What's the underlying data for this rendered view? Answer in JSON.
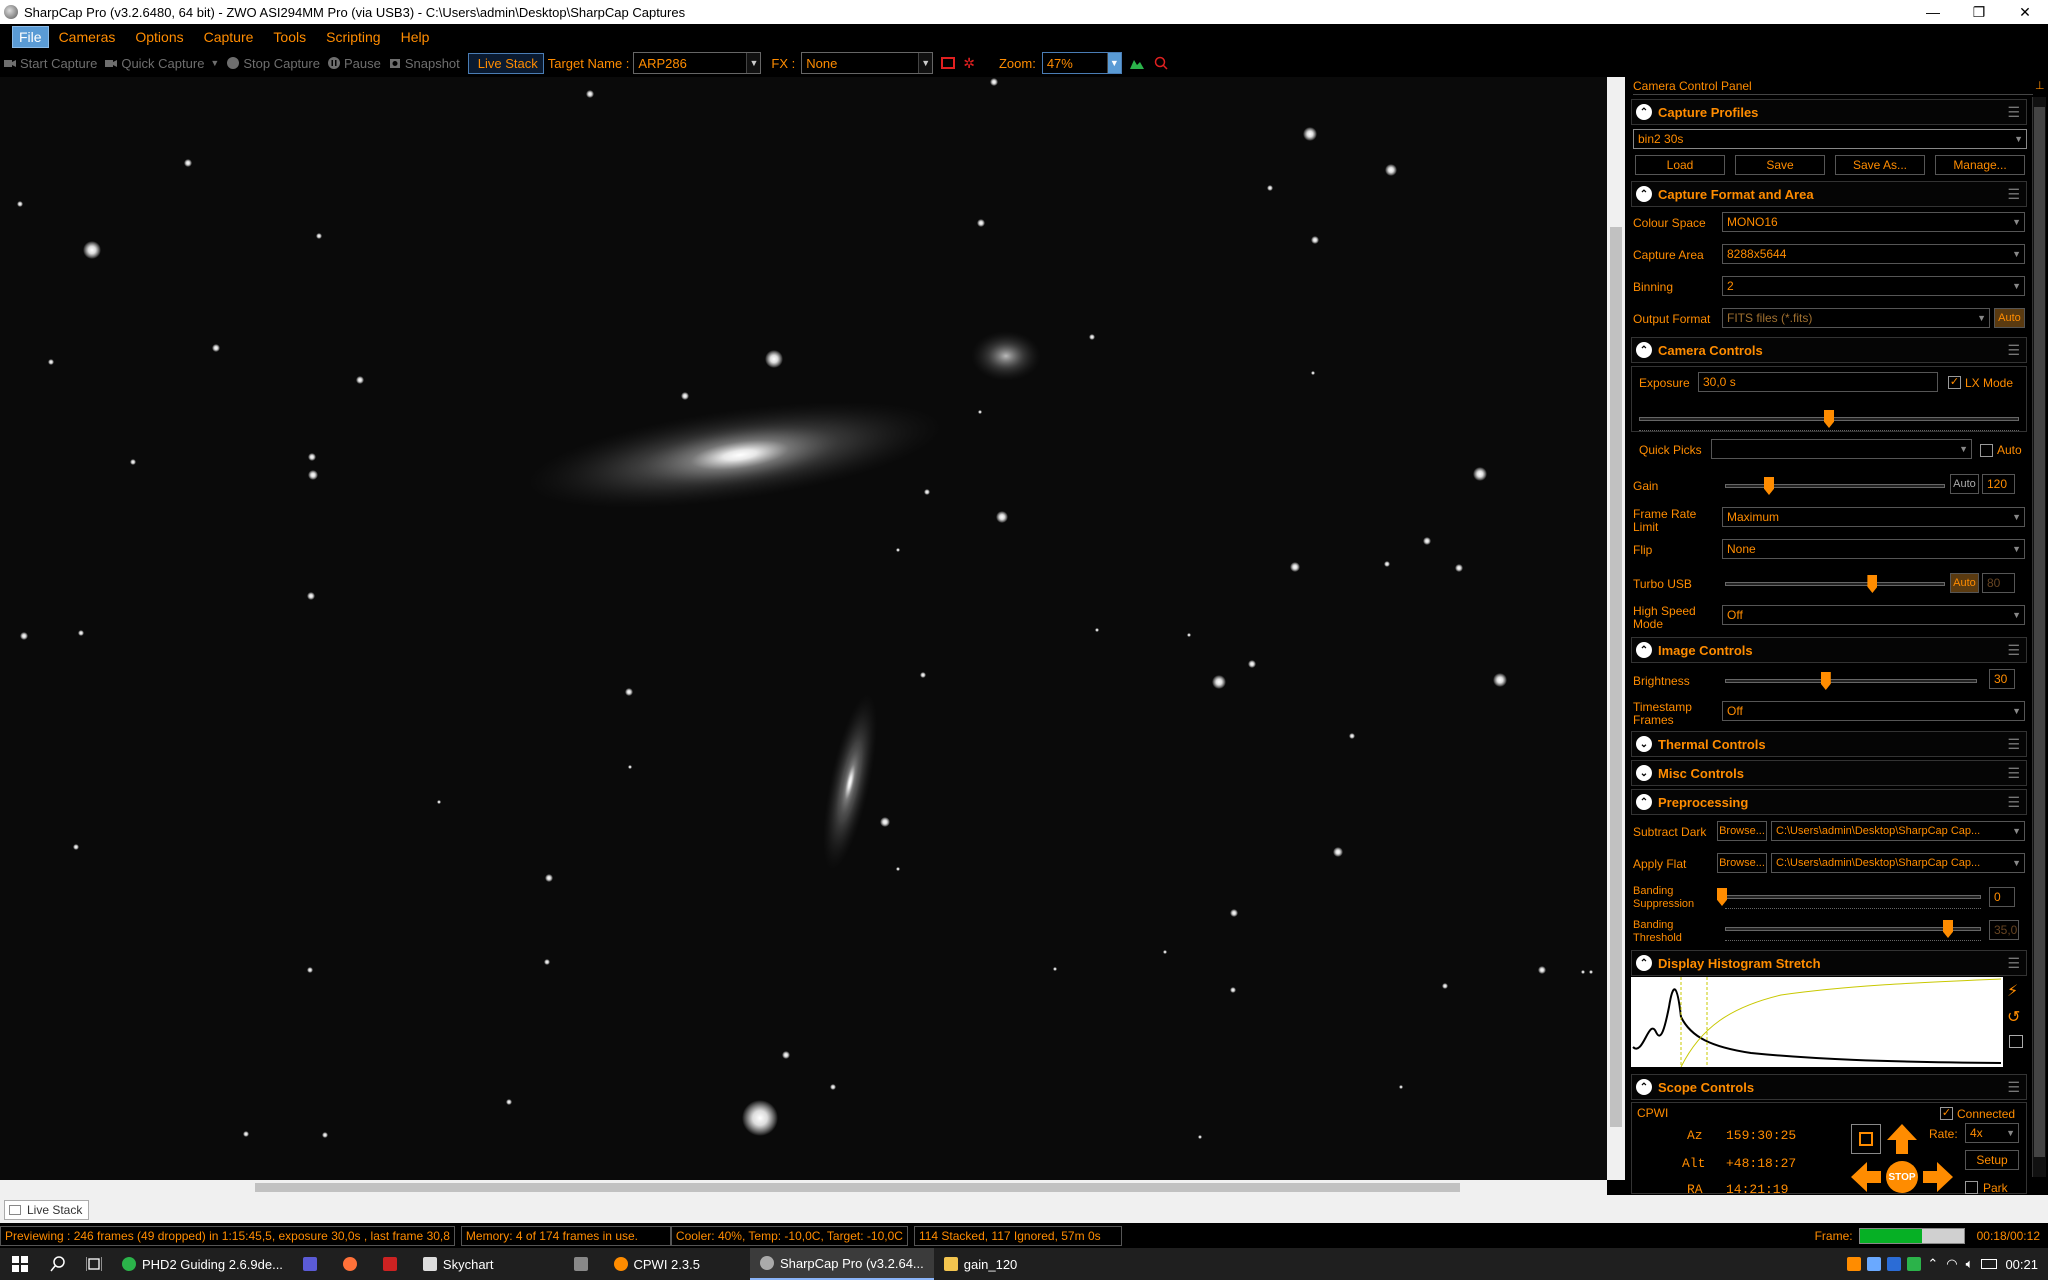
{
  "window": {
    "title": "SharpCap Pro (v3.2.6480, 64 bit) - ZWO ASI294MM Pro (via USB3) - C:\\Users\\admin\\Desktop\\SharpCap Captures",
    "minimize": "—",
    "restore": "❐",
    "close": "✕"
  },
  "menu": [
    "File",
    "Cameras",
    "Options",
    "Capture",
    "Tools",
    "Scripting",
    "Help"
  ],
  "toolbar": {
    "start_capture": "Start Capture",
    "quick_capture": "Quick Capture",
    "stop_capture": "Stop Capture",
    "pause": "Pause",
    "snapshot": "Snapshot",
    "live_stack": "Live Stack",
    "target_label": "Target Name :",
    "target_value": "ARP286",
    "fx_label": "FX :",
    "fx_value": "None",
    "zoom_label": "Zoom:",
    "zoom_value": "47%"
  },
  "viewer": {
    "live_stack_tab": "Live Stack"
  },
  "status": {
    "preview": "Previewing : 246 frames (49 dropped) in 1:15:45,5, exposure 30,0s , last frame 30,8",
    "memory": "Memory: 4 of 174 frames in use.",
    "cooler": "Cooler: 40%, Temp: -10,0C, Target: -10,0C",
    "stack": "114 Stacked, 117 Ignored, 57m 0s",
    "frame_label": "Frame:",
    "frame_progress": 0.6,
    "frame_time": "00:18/00:12"
  },
  "panel": {
    "title": "Camera Control Panel",
    "capture_profiles": {
      "header": "Capture Profiles",
      "selected": "bin2 30s",
      "load": "Load",
      "save": "Save",
      "save_as": "Save As...",
      "manage": "Manage..."
    },
    "format": {
      "header": "Capture Format and Area",
      "colour_space_label": "Colour Space",
      "colour_space": "MONO16",
      "capture_area_label": "Capture Area",
      "capture_area": "8288x5644",
      "binning_label": "Binning",
      "binning": "2",
      "output_format_label": "Output Format",
      "output_format": "FITS files (*.fits)",
      "auto": "Auto"
    },
    "camera": {
      "header": "Camera Controls",
      "exposure_label": "Exposure",
      "exposure": "30,0 s",
      "lx_mode": "LX Mode",
      "quick_picks_label": "Quick Picks",
      "auto": "Auto",
      "gain_label": "Gain",
      "gain": "120",
      "gain_level": 0.2,
      "frame_rate_label": "Frame Rate Limit",
      "frame_rate": "Maximum",
      "flip_label": "Flip",
      "flip": "None",
      "turbo_label": "Turbo USB",
      "turbo": "80",
      "turbo_level": 0.67,
      "high_speed_label": "High Speed Mode",
      "high_speed": "Off",
      "exposure_level": 0.5
    },
    "image": {
      "header": "Image Controls",
      "brightness_label": "Brightness",
      "brightness": "30",
      "brightness_level": 0.4,
      "timestamp_label": "Timestamp Frames",
      "timestamp": "Off"
    },
    "thermal": {
      "header": "Thermal Controls"
    },
    "misc": {
      "header": "Misc Controls"
    },
    "pre": {
      "header": "Preprocessing",
      "dark_label": "Subtract Dark",
      "flat_label": "Apply Flat",
      "browse": "Browse...",
      "dark_path": "C:\\Users\\admin\\Desktop\\SharpCap Cap...",
      "flat_path": "C:\\Users\\admin\\Desktop\\SharpCap Cap...",
      "banding_supp_label": "Banding Suppression",
      "banding_supp": "0",
      "banding_thr_label": "Banding Threshold",
      "banding_thr": "35,0"
    },
    "histogram": {
      "header": "Display Histogram Stretch"
    },
    "scope": {
      "header": "Scope Controls",
      "mount": "CPWI",
      "connected": "Connected",
      "az_label": "Az",
      "az": "159:30:25",
      "alt_label": "Alt",
      "alt": "+48:18:27",
      "ra_label": "RA",
      "ra": "14:21:19",
      "rate_label": "Rate:",
      "rate": "4x",
      "setup": "Setup",
      "stop": "STOP",
      "park": "Park"
    }
  },
  "taskbar": {
    "items": [
      "PHD2 Guiding 2.6.9de...",
      "Skychart",
      "CPWI 2.3.5",
      "SharpCap Pro (v3.2.64...",
      "gain_120"
    ],
    "clock": "00:21"
  }
}
